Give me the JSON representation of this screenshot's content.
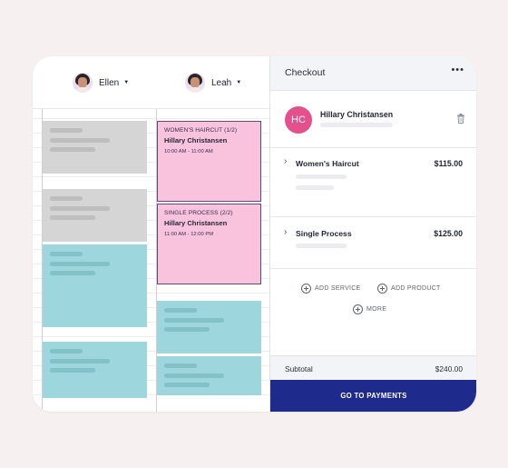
{
  "colors": {
    "page_bg": "#f6f1f0",
    "appointment_pink": "#f9c3de",
    "block_teal": "#9dd6dc",
    "block_gray": "#d5d5d6",
    "avatar_pink": "#e4508c",
    "primary_button": "#1e2a8c"
  },
  "calendar": {
    "staff": [
      {
        "name": "Ellen",
        "icon": "chevron-down-icon"
      },
      {
        "name": "Leah",
        "icon": "chevron-down-icon"
      }
    ],
    "appointments": [
      {
        "service": "WOMEN'S HAIRCUT (1/2)",
        "client": "Hillary Christansen",
        "time": "10:00 AM - 11:00 AM"
      },
      {
        "service": "SINGLE PROCESS (2/2)",
        "client": "Hillary Christansen",
        "time": "11:00 AM - 12:00 PM"
      }
    ]
  },
  "checkout": {
    "title": "Checkout",
    "menu_icon": "more-horizontal-icon",
    "client": {
      "initials": "HC",
      "name": "Hillary Christansen",
      "delete_icon": "trash-icon"
    },
    "services": [
      {
        "name": "Women's Haircut",
        "price": "$115.00"
      },
      {
        "name": "Single Process",
        "price": "$125.00"
      }
    ],
    "actions": {
      "add_service": "ADD SERVICE",
      "add_product": "ADD PRODUCT",
      "more": "MORE"
    },
    "subtotal_label": "Subtotal",
    "subtotal_value": "$240.00",
    "pay_button": "GO TO PAYMENTS"
  }
}
